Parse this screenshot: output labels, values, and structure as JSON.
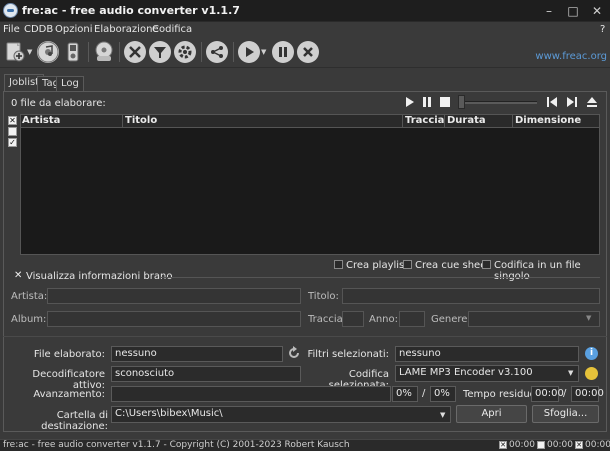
{
  "window": {
    "title": "fre:ac - free audio converter v1.1.7",
    "minimize": "–",
    "maximize": "□",
    "close": "✕"
  },
  "menu": {
    "items": [
      "File",
      "CDDB",
      "Opzioni",
      "Elaborazione",
      "Codifica"
    ],
    "help": "?"
  },
  "toolbar": {
    "link": "www.freac.org"
  },
  "tabs": [
    "Joblist",
    "Tag",
    "Log"
  ],
  "joblist": {
    "files_count": "0 file da elaborare:",
    "columns": [
      "Artista",
      "Titolo",
      "Traccia",
      "Durata",
      "Dimensione"
    ],
    "options": [
      "Crea playlist",
      "Crea cue sheet",
      "Codifica in un file singolo"
    ]
  },
  "track_info": {
    "toggle_label": "Visualizza informazioni brano",
    "artist_label": "Artista:",
    "title_label": "Titolo:",
    "album_label": "Album:",
    "track_label": "Traccia:",
    "year_label": "Anno:",
    "genre_label": "Genere:"
  },
  "status": {
    "file_label": "File elaborato:",
    "file_value": "nessuno",
    "filters_label": "Filtri selezionati:",
    "filters_value": "nessuno",
    "decoder_label": "Decodificatore attivo:",
    "decoder_value": "sconosciuto",
    "encoder_label": "Codifica selezionata:",
    "encoder_value": "LAME MP3 Encoder v3.100",
    "progress_label": "Avanzamento:",
    "progress_file": "0%",
    "progress_sep": "/",
    "progress_total": "0%",
    "remaining_label": "Tempo residuo:",
    "time_file": "00:00",
    "time_sep": "/",
    "time_total": "00:00",
    "dest_label": "Cartella di destinazione:",
    "dest_value": "C:\\Users\\bibex\\Music\\",
    "open_button": "Apri",
    "browse_button": "Sfoglia..."
  },
  "statusbar": {
    "text": "fre:ac - free audio converter v1.1.7 - Copyright (C) 2001-2023 Robert Kausch",
    "time1": "00:00",
    "time2": "00:00",
    "time3": "00:00"
  }
}
